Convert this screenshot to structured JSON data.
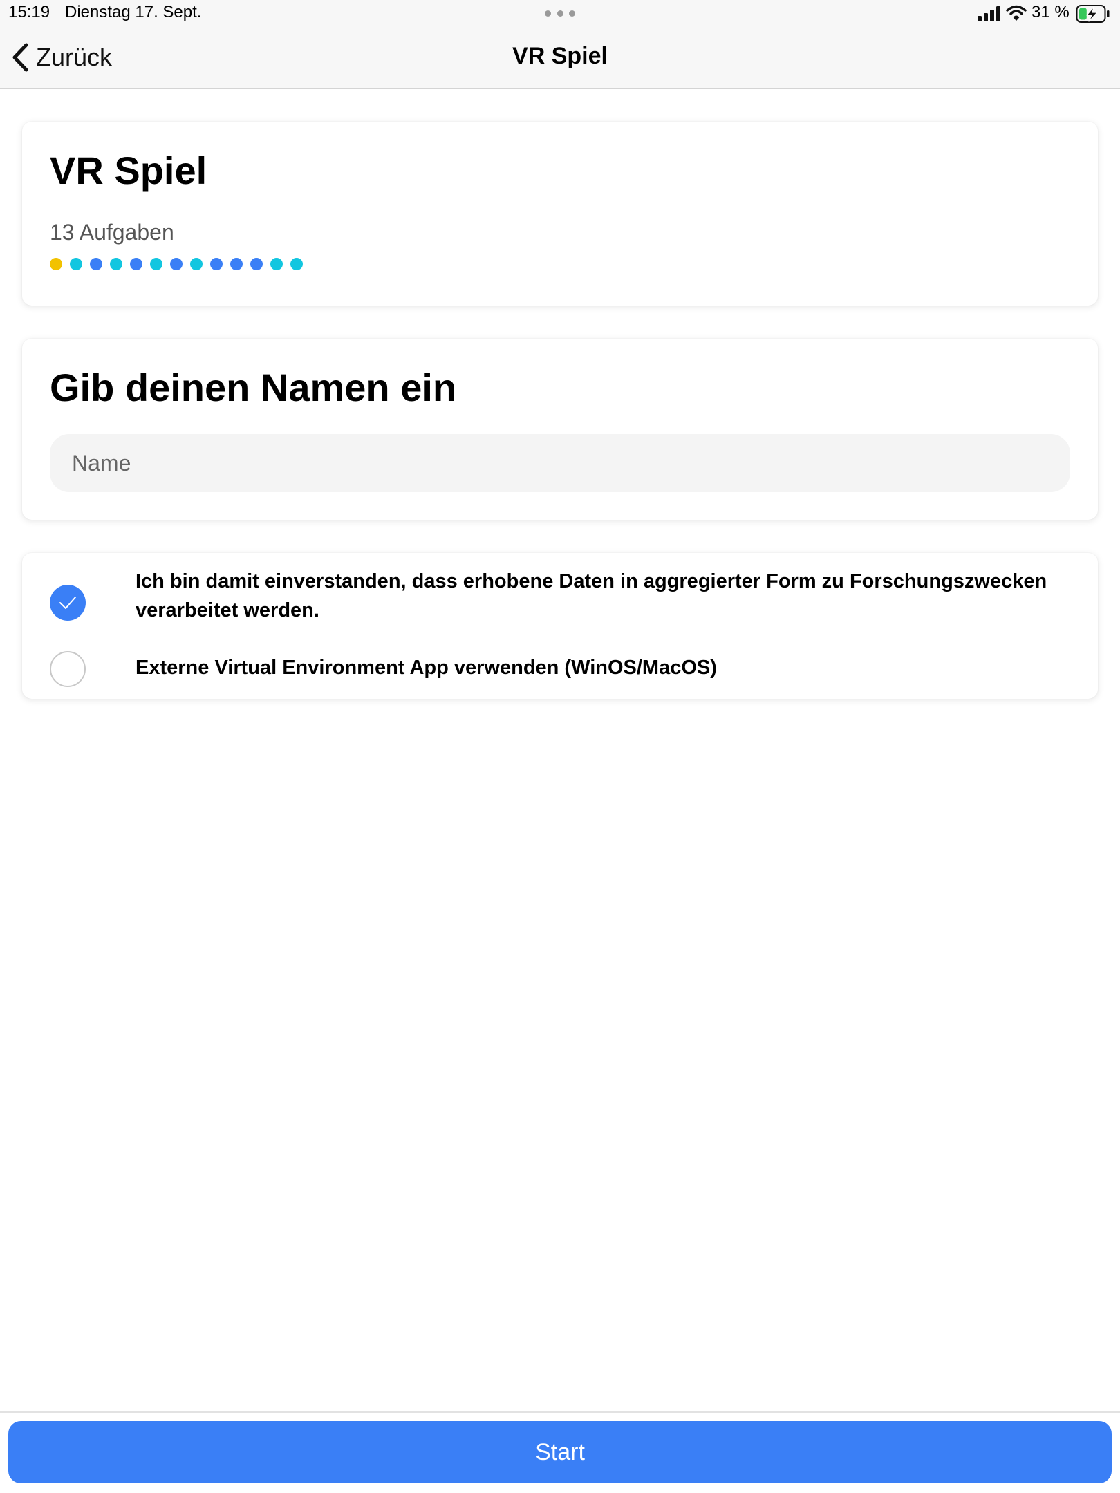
{
  "status_bar": {
    "time": "15:19",
    "date": "Dienstag 17. Sept.",
    "battery_percent": "31 %",
    "battery_level": 0.31,
    "charging": true,
    "icons": [
      "signal-icon",
      "wifi-icon",
      "battery-charging-icon"
    ]
  },
  "nav": {
    "back_label": "Zurück",
    "title": "VR Spiel"
  },
  "game": {
    "title": "VR Spiel",
    "task_count": "13 Aufgaben",
    "task_dot_colors": [
      "#f2c200",
      "#12c6e0",
      "#3a7ff6",
      "#12c6e0",
      "#3a7ff6",
      "#12c6e0",
      "#3a7ff6",
      "#12c6e0",
      "#3a7ff6",
      "#3a7ff6",
      "#3a7ff6",
      "#12c6e0",
      "#12c6e0"
    ]
  },
  "name_form": {
    "heading": "Gib deinen Namen ein",
    "placeholder": "Name",
    "value": ""
  },
  "consent": {
    "items": [
      {
        "label": "Ich bin damit einverstanden, dass erhobene Daten in aggregierter Form zu Forschungszwecken verarbeitet werden.",
        "checked": true
      },
      {
        "label": "Externe Virtual Environment App verwenden (WinOS/MacOS)",
        "checked": false
      }
    ]
  },
  "start_button": {
    "label": "Start"
  },
  "colors": {
    "accent": "#3a7ff6",
    "cyan": "#12c6e0",
    "yellow": "#f2c200",
    "battery_green": "#34c759"
  }
}
